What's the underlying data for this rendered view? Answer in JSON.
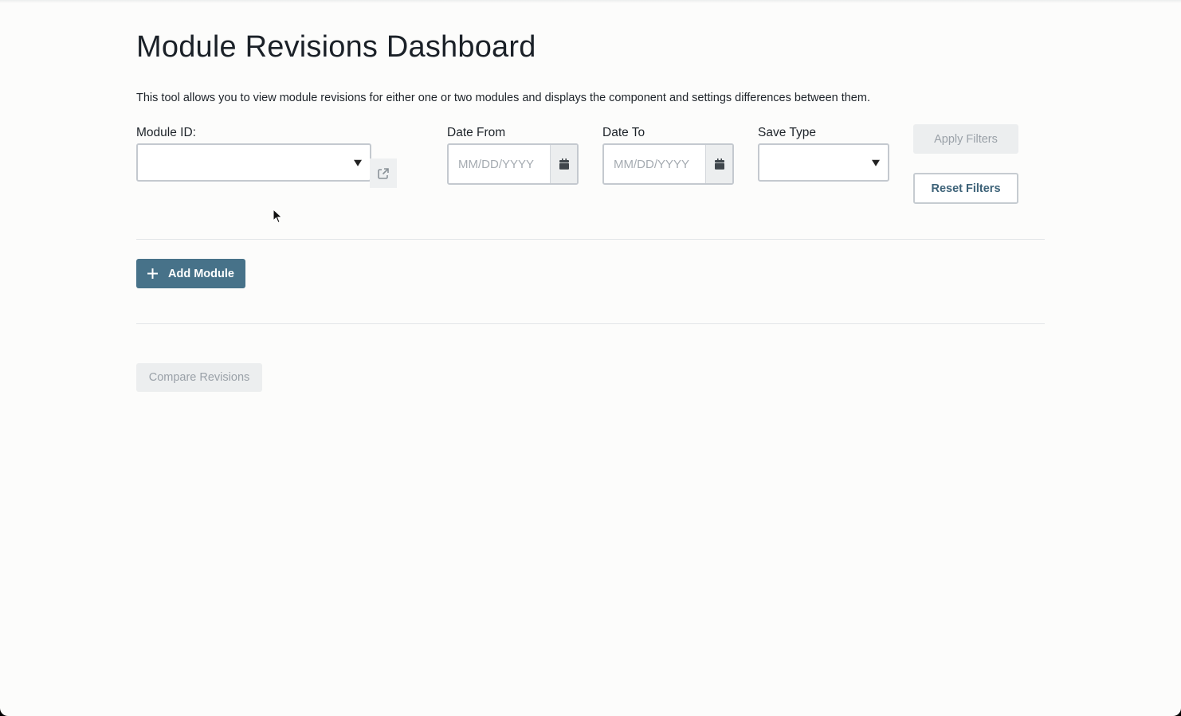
{
  "page": {
    "title": "Module Revisions Dashboard",
    "description": "This tool allows you to view module revisions for either one or two modules and displays the component and settings differences between them."
  },
  "filters": {
    "module_id": {
      "label": "Module ID:",
      "value": ""
    },
    "date_from": {
      "label": "Date From",
      "placeholder": "MM/DD/YYYY"
    },
    "date_to": {
      "label": "Date To",
      "placeholder": "MM/DD/YYYY"
    },
    "save_type": {
      "label": "Save Type",
      "value": ""
    },
    "apply_label": "Apply Filters",
    "reset_label": "Reset Filters"
  },
  "actions": {
    "add_module_label": "Add Module",
    "compare_label": "Compare Revisions"
  },
  "icons": {
    "external_link": "external-link-icon",
    "calendar": "calendar-icon",
    "plus": "plus-icon",
    "dropdown": "chevron-down-icon"
  },
  "colors": {
    "primary": "#477289",
    "outline_text": "#3d6278",
    "disabled_bg": "#eceeef",
    "disabled_text": "#9aa1a8"
  }
}
